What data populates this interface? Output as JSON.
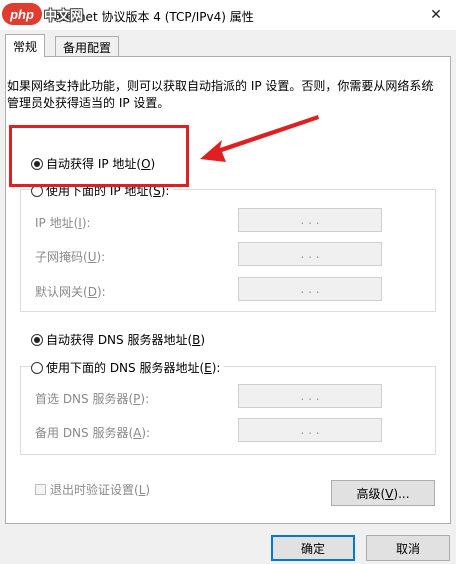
{
  "window": {
    "title": "Internet 协议版本 4 (TCP/IPv4) 属性",
    "close_glyph": "✕"
  },
  "watermark": {
    "logo_text": "php",
    "site_text": "中文网"
  },
  "tabs": [
    {
      "label": "常规",
      "active": true
    },
    {
      "label": "备用配置",
      "active": false
    }
  ],
  "description": "如果网络支持此功能，则可以获取自动指派的 IP 设置。否则，你需要从网络系统管理员处获得适当的 IP 设置。",
  "ip_section": {
    "auto_option": {
      "label": "自动获得 IP 地址(",
      "key": "O",
      "label_end": ")",
      "checked": true
    },
    "manual_option": {
      "label": "使用下面的 IP 地址(",
      "key": "S",
      "label_end": "):",
      "checked": false
    },
    "fields": [
      {
        "label": "IP 地址(",
        "key": "I",
        "label_end": "):",
        "value": ".   .   ."
      },
      {
        "label": "子网掩码(",
        "key": "U",
        "label_end": "):",
        "value": ".   .   ."
      },
      {
        "label": "默认网关(",
        "key": "D",
        "label_end": "):",
        "value": ".   .   ."
      }
    ]
  },
  "dns_section": {
    "auto_option": {
      "label": "自动获得 DNS 服务器地址(",
      "key": "B",
      "label_end": ")",
      "checked": true
    },
    "manual_option": {
      "label": "使用下面的 DNS 服务器地址(",
      "key": "E",
      "label_end": "):",
      "checked": false
    },
    "fields": [
      {
        "label": "首选 DNS 服务器(",
        "key": "P",
        "label_end": "):",
        "value": ".   .   ."
      },
      {
        "label": "备用 DNS 服务器(",
        "key": "A",
        "label_end": "):",
        "value": ".   .   ."
      }
    ]
  },
  "validate_checkbox": {
    "label": "退出时验证设置(",
    "key": "L",
    "label_end": ")",
    "checked": false
  },
  "advanced_button": {
    "label": "高级(",
    "key": "V",
    "label_end": ")..."
  },
  "ok_button": {
    "label": "确定"
  },
  "cancel_button": {
    "label": "取消"
  },
  "colors": {
    "annotation_red": "#e02020",
    "accent_blue": "#0078d7"
  }
}
